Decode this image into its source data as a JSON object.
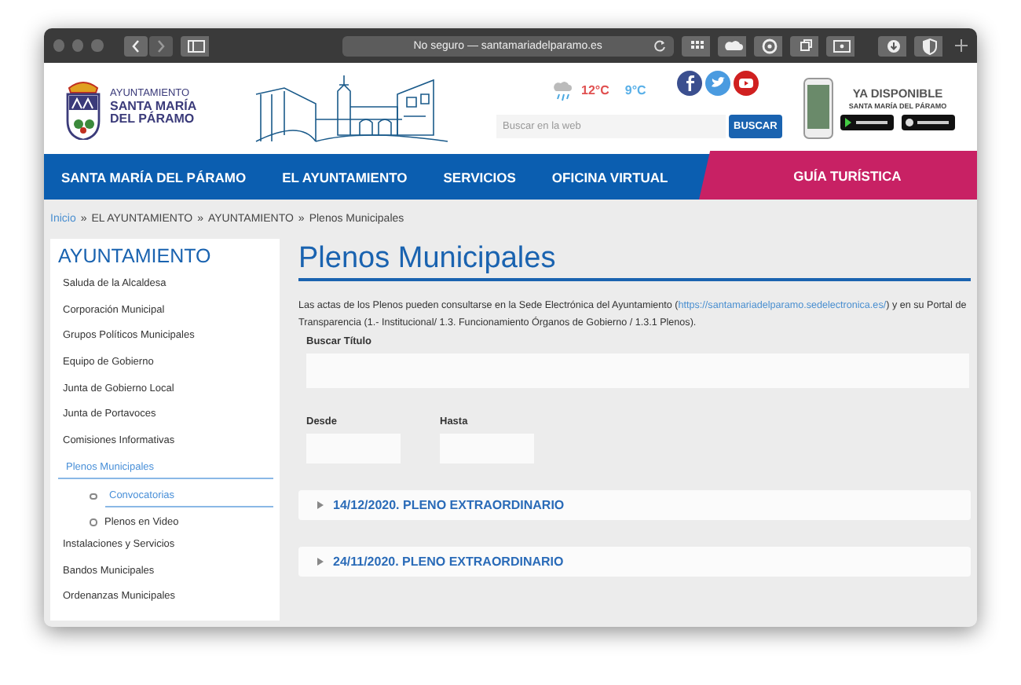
{
  "browser": {
    "address_prefix": "No seguro —",
    "address_domain": "santamariadelparamo.es"
  },
  "header": {
    "logo_lines": [
      "AYUNTAMIENTO",
      "SANTA MARÍA",
      "DEL PÁRAMO"
    ],
    "temp_max": "12°C",
    "temp_min": "9°C",
    "search": {
      "placeholder": "Buscar en la web",
      "button": "BUSCAR"
    },
    "app_promo": {
      "title": "YA DISPONIBLE",
      "subtitle": "SANTA MARÍA DEL PÁRAMO"
    }
  },
  "nav": {
    "items": [
      {
        "label": "SANTA MARÍA DEL PÁRAMO"
      },
      {
        "label": "EL AYUNTAMIENTO"
      },
      {
        "label": "SERVICIOS"
      },
      {
        "label": "OFICINA VIRTUAL"
      }
    ],
    "featured": "GUÍA TURÍSTICA"
  },
  "breadcrumb": [
    {
      "label": "Inicio",
      "kind": "link"
    },
    {
      "label": "EL AYUNTAMIENTO",
      "kind": "text"
    },
    {
      "label": "AYUNTAMIENTO",
      "kind": "text"
    },
    {
      "label": "Plenos Municipales",
      "kind": "text"
    }
  ],
  "breadcrumb_separator": "»",
  "sidebar": {
    "title": "AYUNTAMIENTO",
    "items": [
      {
        "label": "Saluda de la Alcaldesa",
        "selected": false
      },
      {
        "label": "Corporación Municipal",
        "selected": false
      },
      {
        "label": "Grupos Políticos Municipales",
        "selected": false
      },
      {
        "label": "Equipo de Gobierno",
        "selected": false
      },
      {
        "label": "Junta de Gobierno Local",
        "selected": false
      },
      {
        "label": "Junta de Portavoces",
        "selected": false
      },
      {
        "label": "Comisiones Informativas",
        "selected": false
      },
      {
        "label": "Plenos Municipales",
        "selected": true,
        "children": [
          {
            "label": "Convocatorias",
            "selected": true
          },
          {
            "label": "Plenos en Video",
            "selected": false
          }
        ]
      },
      {
        "label": "Instalaciones y Servicios",
        "selected": false
      },
      {
        "label": "Bandos Municipales",
        "selected": false
      },
      {
        "label": "Ordenanzas Municipales",
        "selected": false
      }
    ]
  },
  "main": {
    "title": "Plenos Municipales",
    "intro_before": "Las actas de los Plenos pueden consultarse en la Sede Electrónica del Ayuntamiento (",
    "intro_link": "https://santamariadelparamo.sedelectronica.es/",
    "intro_after": ") y en su Portal de Transparencia (1.- Institucional/ 1.3. Funcionamiento Órganos de Gobierno / 1.3.1 Plenos).",
    "filters": {
      "title_label": "Buscar Título",
      "from_label": "Desde",
      "to_label": "Hasta"
    },
    "sessions": [
      {
        "label": "14/12/2020. PLENO EXTRAORDINARIO",
        "expanded": false
      },
      {
        "label": "24/11/2020. PLENO EXTRAORDINARIO",
        "expanded": false
      }
    ]
  }
}
